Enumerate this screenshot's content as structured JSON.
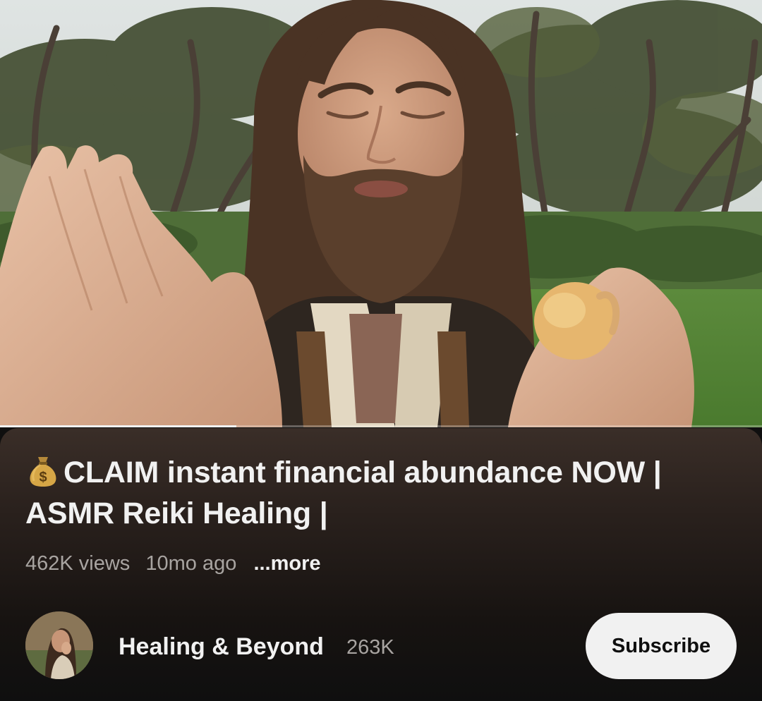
{
  "video": {
    "title": "CLAIM instant financial abundance NOW | ASMR Reiki Healing |",
    "title_emoji_icon": "money-bag-icon",
    "progress_fraction": 0.31
  },
  "meta": {
    "views": "462K views",
    "age": "10mo ago",
    "more_label": "...more"
  },
  "channel": {
    "name": "Healing & Beyond",
    "subscriber_count": "263K",
    "subscribe_label": "Subscribe"
  },
  "colors": {
    "text_primary": "#f1f1f1",
    "text_secondary": "#a8a4a1",
    "panel_top": "#3a2e28",
    "background": "#0f0f0f",
    "subscribe_bg": "#f1f1f1"
  }
}
